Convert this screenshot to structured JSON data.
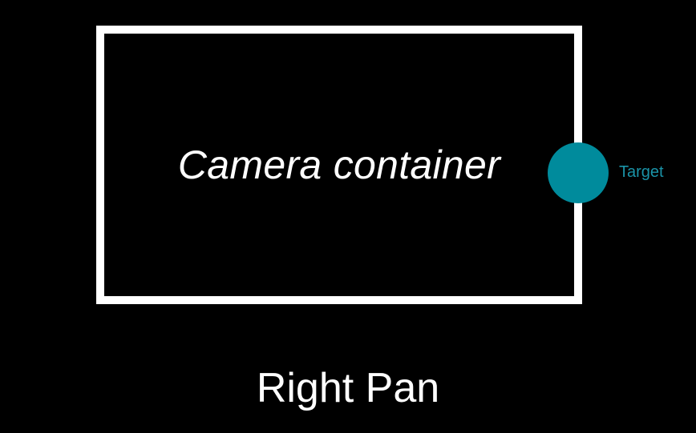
{
  "camera": {
    "label": "Camera container"
  },
  "target": {
    "label": "Target",
    "color": "#008b9c"
  },
  "caption": {
    "text": "Right Pan"
  }
}
